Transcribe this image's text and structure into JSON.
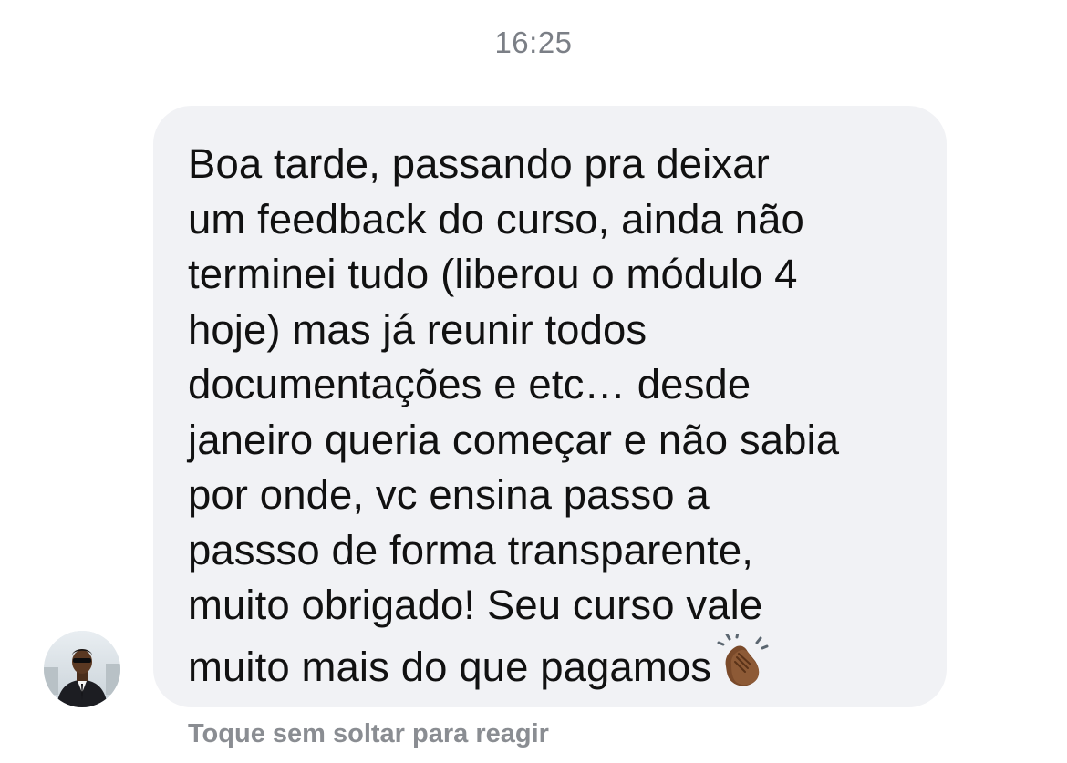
{
  "chat": {
    "timestamp": "16:25",
    "message": {
      "text": "Boa tarde, passando pra deixar\num feedback do curso, ainda não\nterminei tudo (liberou o módulo 4\nhoje) mas já reunir todos\ndocumentações e etc… desde\njaneiro queria começar e não sabia\npor onde, vc ensina passo a\npassso de forma transparente,\nmuito obrigado! Seu curso vale\nmuito mais do que pagamos",
      "emoji_icon": "clapping-hands-medium-dark-skin-icon"
    },
    "reaction_hint": "Toque sem soltar para reagir",
    "sender_avatar_icon": "man-in-suit-avatar-icon"
  },
  "colors": {
    "bubble_background": "#f1f2f5",
    "timestamp_text": "#7b7f86",
    "hint_text": "#8a8d92",
    "message_text": "#111111"
  }
}
